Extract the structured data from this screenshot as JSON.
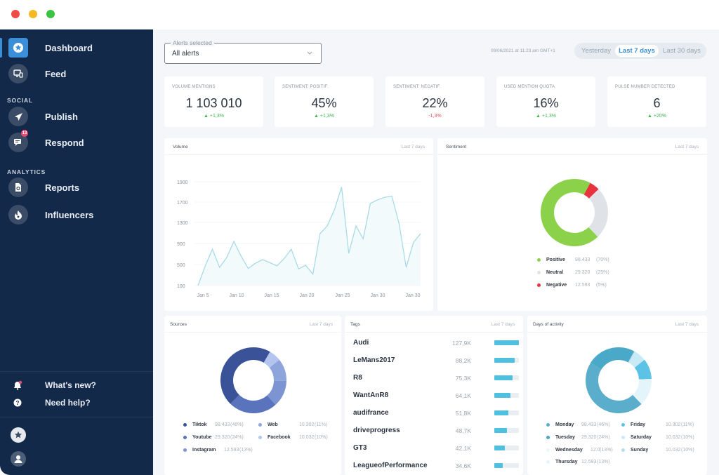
{
  "window": {
    "controls": [
      "close",
      "minimize",
      "maximize"
    ]
  },
  "sidebar": {
    "items": [
      {
        "label": "Dashboard",
        "icon": "star-icon",
        "active": true
      },
      {
        "label": "Feed",
        "icon": "monitor-icon"
      },
      {
        "label": "Publish",
        "icon": "paper-plane-icon"
      },
      {
        "label": "Respond",
        "icon": "chat-icon",
        "badge": "13"
      },
      {
        "label": "Reports",
        "icon": "report-icon"
      },
      {
        "label": "Influencers",
        "icon": "flame-icon"
      }
    ],
    "sections": {
      "social": "SOCIAL",
      "analytics": "ANALYTICS"
    },
    "footer": [
      {
        "label": "What's new?",
        "icon": "bell-icon"
      },
      {
        "label": "Need help?",
        "icon": "help-icon"
      }
    ],
    "bottom_icons": [
      "star-icon",
      "user-avatar-icon"
    ]
  },
  "header": {
    "alerts_select": {
      "legend": "Alerts selected",
      "value": "All alerts"
    },
    "timestamp": "09/06/2021 at 11:23 am GMT+1",
    "ranges": [
      "Yesterday",
      "Last 7 days",
      "Last 30 days"
    ],
    "active_range": "Last 7 days"
  },
  "kpis": [
    {
      "label": "VOLUME MENTIONS",
      "value": "1 103 010",
      "delta": "▲ +1,3%",
      "trend": "up"
    },
    {
      "label": "SENTIMENT: POSITIF",
      "value": "45%",
      "delta": "▲ +1,3%",
      "trend": "up"
    },
    {
      "label": "SENTIMENT: NEGATIF",
      "value": "22%",
      "delta": "-1,3%",
      "trend": "down"
    },
    {
      "label": "USED MENTION QUOTA",
      "value": "16%",
      "delta": "▲ +1,3%",
      "trend": "up"
    },
    {
      "label": "PULSE NUMBER DETECTED",
      "value": "6",
      "delta": "▲ +20%",
      "trend": "up"
    }
  ],
  "cards": {
    "volume": {
      "title": "Volume",
      "range": "Last 7 days"
    },
    "sentiment": {
      "title": "Sentiment",
      "range": "Last 7 days"
    },
    "sources": {
      "title": "Sources",
      "range": "Last 7 days"
    },
    "tags": {
      "title": "Tags",
      "range": "Last 7 days"
    },
    "days": {
      "title": "Days of activity",
      "range": "Last 7 days"
    }
  },
  "colors": {
    "accent": "#3a8fd8",
    "sidebar": "#13294a",
    "positive": "#8bd14a",
    "neutral": "#dfe3e8",
    "negative": "#e8333f",
    "line": "#a8dbe6"
  },
  "chart_data": [
    {
      "type": "line",
      "title": "Volume",
      "x_tick_labels": [
        "Jan 5",
        "Jan 10",
        "Jan 15",
        "Jan 20",
        "Jan 25",
        "Jan 30",
        "Jan 30"
      ],
      "y_tick_labels": [
        "100",
        "500",
        "900",
        "1300",
        "1700",
        "1900"
      ],
      "y_ticks": [
        100,
        500,
        900,
        1300,
        1700,
        2100
      ],
      "ylim": [
        100,
        2100
      ],
      "values": [
        100,
        475,
        800,
        450,
        640,
        950,
        665,
        430,
        530,
        600,
        540,
        480,
        620,
        800,
        420,
        490,
        320,
        1100,
        1250,
        1560,
        2000,
        720,
        1250,
        1000,
        1680,
        1750,
        1800,
        1820,
        1300,
        450,
        930,
        1100
      ],
      "grid": true
    },
    {
      "type": "pie",
      "title": "Sentiment",
      "slices": [
        {
          "name": "Positive",
          "value": 98433,
          "display": "98.433",
          "pct": "(70%)",
          "share": 70,
          "color": "#8bd14a"
        },
        {
          "name": "Neutral",
          "value": 29320,
          "display": "29.320",
          "pct": "(25%)",
          "share": 25,
          "color": "#dfe3e8"
        },
        {
          "name": "Negative",
          "value": 12593,
          "display": "12.593",
          "pct": "(5%)",
          "share": 5,
          "color": "#e8333f"
        }
      ]
    },
    {
      "type": "pie",
      "title": "Sources",
      "slices": [
        {
          "name": "Tiktok",
          "value": 98433,
          "display": "98.433",
          "pct": "(46%)",
          "share": 46,
          "color": "#3a5298"
        },
        {
          "name": "Youtube",
          "value": 29320,
          "display": "29.320",
          "pct": "(24%)",
          "share": 24,
          "color": "#5a73bd"
        },
        {
          "name": "Instagram",
          "value": 12593,
          "display": "12.593",
          "pct": "(13%)",
          "share": 13,
          "color": "#7d94d2"
        },
        {
          "name": "Web",
          "value": 10302,
          "display": "10.302",
          "pct": "(11%)",
          "share": 11,
          "color": "#8ea5dc"
        },
        {
          "name": "Facebook",
          "value": 10032,
          "display": "10.032",
          "pct": "(10%)",
          "share": 6,
          "color": "#b3c5ef"
        }
      ]
    },
    {
      "type": "bar",
      "title": "Tags",
      "categories": [
        "Audi",
        "LeMans2017",
        "R8",
        "WantAnR8",
        "audifrance",
        "driveprogress",
        "GT3",
        "LeagueofPerformance"
      ],
      "values": [
        127.9,
        88.2,
        75.3,
        64.1,
        51.8,
        48.7,
        42.1,
        34.6
      ],
      "labels": [
        "127,9K",
        "88,2K",
        "75,3K",
        "64,1K",
        "51,8K",
        "48,7K",
        "42,1K",
        "34,6K"
      ],
      "fill_fractions": [
        1.0,
        0.84,
        0.74,
        0.66,
        0.58,
        0.5,
        0.42,
        0.33
      ]
    },
    {
      "type": "pie",
      "title": "Days of activity",
      "slices": [
        {
          "name": "Monday",
          "value": 98433,
          "display": "98.433",
          "pct": "(46%)",
          "share": 46,
          "color": "#5aaecb"
        },
        {
          "name": "Tuesday",
          "value": 29320,
          "display": "29.320",
          "pct": "(24%)",
          "share": 24,
          "color": "#4aa8c9"
        },
        {
          "name": "Wednesday",
          "value": 12.0,
          "display": "12.0",
          "pct": "(13%)",
          "share": 0.5,
          "color": "#eaf7fb"
        },
        {
          "name": "Thursday",
          "value": 12593,
          "display": "12.593",
          "pct": "(13%)",
          "share": 13,
          "color": "#e3f5fb"
        },
        {
          "name": "Friday",
          "value": 10302,
          "display": "10.302",
          "pct": "(11%)",
          "share": 10,
          "color": "#5cc3e6"
        },
        {
          "name": "Saturday",
          "value": 10032,
          "display": "10.032",
          "pct": "(10%)",
          "share": 6,
          "color": "#c7eaf5"
        },
        {
          "name": "Sunday",
          "value": 10032,
          "display": "10.032",
          "pct": "(10%)",
          "share": 0.5,
          "color": "#b6dcea"
        }
      ]
    }
  ]
}
